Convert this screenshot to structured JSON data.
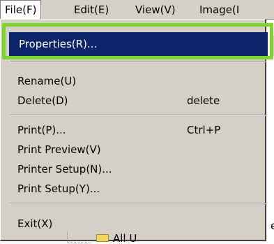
{
  "menubar": {
    "items": [
      {
        "label": "File(F)"
      },
      {
        "label": "Edit(E)"
      },
      {
        "label": "View(V)"
      },
      {
        "label": "Image(I"
      }
    ]
  },
  "menu": {
    "selected": {
      "label": "Properties(R)..."
    },
    "items": [
      {
        "label": "Rename(U)",
        "shortcut": ""
      },
      {
        "label": "Delete(D)",
        "shortcut": "delete"
      },
      {
        "label": "Print(P)...",
        "shortcut": "Ctrl+P"
      },
      {
        "label": "Print Preview(V)",
        "shortcut": ""
      },
      {
        "label": "Printer Setup(N)...",
        "shortcut": ""
      },
      {
        "label": "Print Setup(Y)...",
        "shortcut": ""
      },
      {
        "label": "Exit(X)",
        "shortcut": ""
      }
    ]
  },
  "background": {
    "clipped_text": "etl",
    "bottom_label": "All U"
  }
}
